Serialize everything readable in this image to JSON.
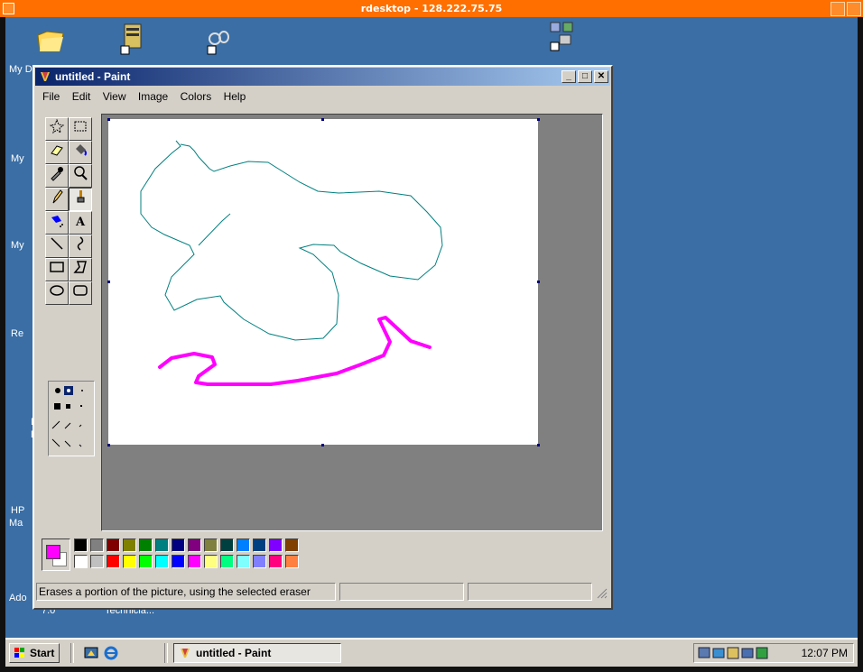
{
  "rdesktop": {
    "title": "rdesktop - 128.222.75.75"
  },
  "desktop": {
    "labels": [
      "My D",
      "My",
      "My",
      "Re",
      "I",
      "E",
      "HP",
      "Ma",
      "Ado",
      "7.0",
      "Technicia..."
    ]
  },
  "paint": {
    "title": "untitled - Paint",
    "menu": [
      "File",
      "Edit",
      "View",
      "Image",
      "Colors",
      "Help"
    ],
    "status_text": "Erases a portion of the picture, using the selected eraser",
    "foreground_color": "#ff00ff",
    "background_color": "#ffffff",
    "palette_top": [
      "#000000",
      "#808080",
      "#800000",
      "#808000",
      "#008000",
      "#008080",
      "#000080",
      "#800080",
      "#808040",
      "#004040",
      "#0080ff",
      "#004080",
      "#8000ff",
      "#804000"
    ],
    "palette_bottom": [
      "#ffffff",
      "#c0c0c0",
      "#ff0000",
      "#ffff00",
      "#00ff00",
      "#00ffff",
      "#0000ff",
      "#ff00ff",
      "#ffff80",
      "#00ff80",
      "#80ffff",
      "#8080ff",
      "#ff0080",
      "#ff8040"
    ],
    "tools": [
      "free-form-select-icon",
      "rect-select-icon",
      "eraser-icon",
      "fill-icon",
      "color-picker-icon",
      "magnifier-icon",
      "pencil-icon",
      "brush-icon",
      "airbrush-icon",
      "text-icon",
      "line-icon",
      "curve-icon",
      "rectangle-icon",
      "polygon-icon",
      "ellipse-icon",
      "rounded-rect-icon"
    ],
    "text_tool_glyph": "A"
  },
  "taskbar": {
    "start_label": "Start",
    "task_label": "untitled - Paint",
    "clock": "12:07 PM"
  }
}
